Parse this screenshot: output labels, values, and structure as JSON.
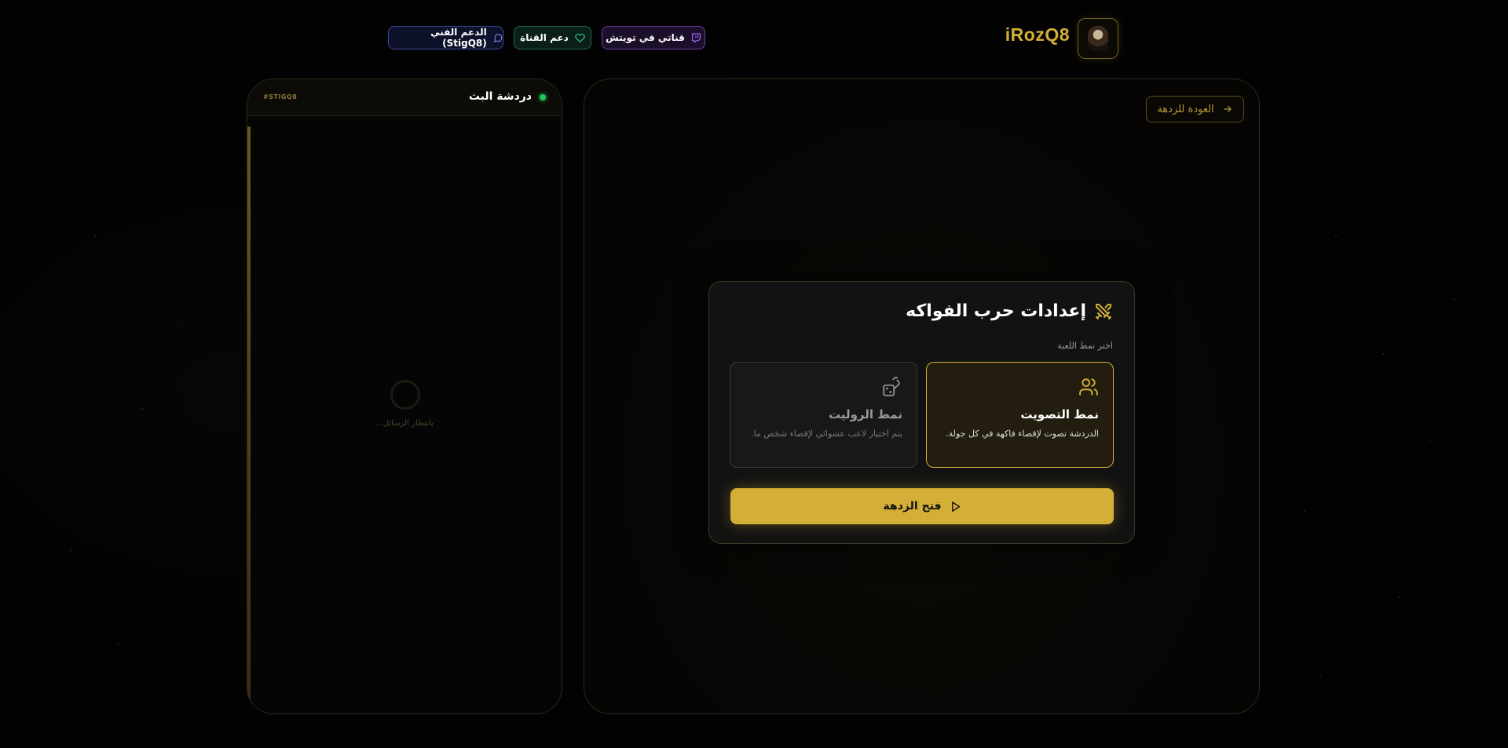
{
  "header": {
    "brand": "iRozQ8",
    "pills": {
      "twitch": "قناتي في تويتش",
      "support": "دعم القناة",
      "tech": "الدعم الفني (StigQ8)"
    }
  },
  "chat": {
    "title": "دردشة البث",
    "channel": "#STIGQ8",
    "waiting": "بانتظار الرسائل..."
  },
  "main": {
    "back_label": "العودة للزدهة",
    "card": {
      "title": "إعدادات حرب الفواكه",
      "mode_label": "اختر نمط اللعبة",
      "modes": [
        {
          "name": "نمط التصويت",
          "desc": "الدردشة تصوت لإقصاء فاكهة في كل جولة.",
          "selected": true
        },
        {
          "name": "نمط الروليت",
          "desc": "يتم اختيار لاعب عشوائي لإقصاء شخص ما.",
          "selected": false
        }
      ],
      "start_label": "فتح الزدهة"
    }
  },
  "colors": {
    "accent": "#d4af37",
    "twitch": "#a970ff",
    "support": "#34d399",
    "tech": "#7c8cff",
    "live": "#22c55e"
  },
  "icons": [
    "twitch-icon",
    "heart-icon",
    "chat-bubble-icon",
    "arrow-right-icon",
    "swords-icon",
    "users-icon",
    "dice-icon",
    "play-icon"
  ]
}
